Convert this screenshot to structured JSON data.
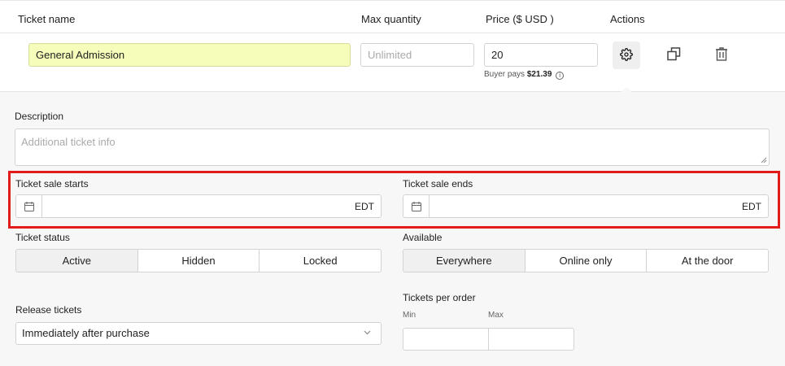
{
  "header": {
    "ticket_name": "Ticket name",
    "max_quantity": "Max quantity",
    "price": "Price ($ USD )",
    "actions": "Actions"
  },
  "ticket": {
    "name_value": "General Admission",
    "max_quantity_placeholder": "Unlimited",
    "price_value": "20",
    "buyer_pays_prefix": "Buyer pays",
    "buyer_pays_amount": "$21.39",
    "info_glyph": "i"
  },
  "icons": [
    "gear-icon",
    "duplicate-icon",
    "trash-icon",
    "calendar-icon",
    "chevron-down-icon",
    "info-icon"
  ],
  "description": {
    "label": "Description",
    "placeholder": "Additional ticket info"
  },
  "sale_starts": {
    "label": "Ticket sale starts",
    "timezone": "EDT"
  },
  "sale_ends": {
    "label": "Ticket sale ends",
    "timezone": "EDT"
  },
  "ticket_status": {
    "label": "Ticket status",
    "options": [
      "Active",
      "Hidden",
      "Locked"
    ],
    "selected": "Active"
  },
  "available": {
    "label": "Available",
    "options": [
      "Everywhere",
      "Online only",
      "At the door"
    ],
    "selected": "Everywhere"
  },
  "release": {
    "label": "Release tickets",
    "selected": "Immediately after purchase"
  },
  "tickets_per_order": {
    "label": "Tickets per order",
    "min_label": "Min",
    "max_label": "Max"
  },
  "colors": {
    "highlight_input": "#f6fcb9",
    "annotation_red": "#e21b1b"
  }
}
